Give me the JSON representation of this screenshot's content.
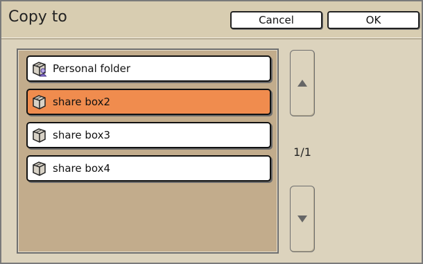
{
  "dialog": {
    "title": "Copy to",
    "cancel_label": "Cancel",
    "ok_label": "OK"
  },
  "list": {
    "items": [
      {
        "label": "Personal folder",
        "icon": "personal-folder-icon",
        "selected": false
      },
      {
        "label": "share box2",
        "icon": "box-icon",
        "selected": true
      },
      {
        "label": "share box3",
        "icon": "box-icon",
        "selected": false
      },
      {
        "label": "share box4",
        "icon": "box-icon",
        "selected": false
      }
    ]
  },
  "pager": {
    "page_label": "1/1",
    "up_icon": "up-arrow-icon",
    "down_icon": "down-arrow-icon"
  },
  "colors": {
    "background": "#dcd3bd",
    "list_background": "#c2ac8c",
    "selected": "#f08c4e"
  }
}
